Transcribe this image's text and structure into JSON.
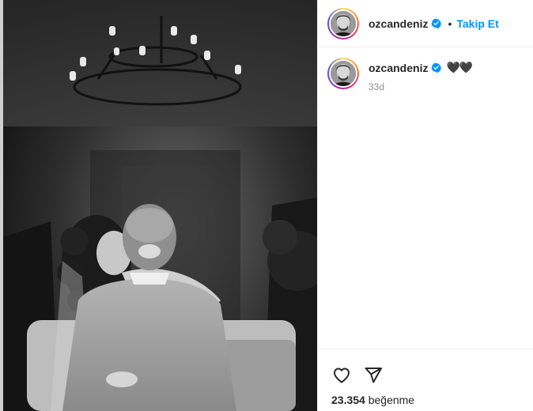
{
  "post": {
    "username": "ozcandeniz",
    "follow_label": "Takip Et",
    "separator": "•",
    "caption": "🖤🖤",
    "time_ago": "33d",
    "likes_count": "23.354",
    "likes_word": "beğenme"
  },
  "colors": {
    "link_blue": "#0095f6",
    "verified_blue": "#0095f6",
    "muted_text": "#8e8e8e",
    "border": "#efefef"
  },
  "icons": {
    "verified": "verified-badge-icon",
    "like": "heart-icon",
    "share": "paper-plane-icon"
  }
}
